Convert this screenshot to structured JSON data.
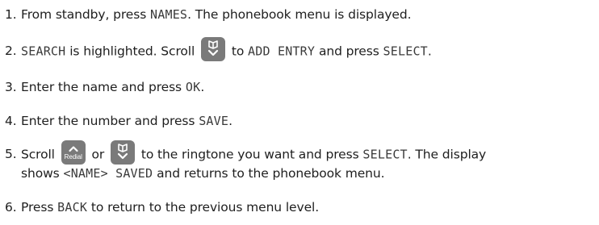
{
  "steps": [
    {
      "num": "1.",
      "parts": [
        "From standby, press ",
        "NAMES",
        ". The phonebook menu is displayed."
      ]
    },
    {
      "num": "2.",
      "parts": [
        "SEARCH",
        " is highlighted. Scroll ",
        " to ",
        "ADD ENTRY",
        " and press ",
        "SELECT",
        "."
      ]
    },
    {
      "num": "3.",
      "parts": [
        "Enter the name and press ",
        "OK",
        "."
      ]
    },
    {
      "num": "4.",
      "parts": [
        "Enter the number and press ",
        "SAVE",
        "."
      ]
    },
    {
      "num": "5.",
      "parts": [
        "Scroll ",
        " or ",
        " to the ringtone you want and press ",
        "SELECT",
        ". The display",
        "shows ",
        "<NAME> SAVED",
        " and returns to the phonebook menu."
      ]
    },
    {
      "num": "6.",
      "parts": [
        "Press ",
        "BACK",
        " to return to the previous menu level."
      ]
    }
  ],
  "icons": {
    "phonebook_down_key": "phonebook-down-icon",
    "redial_up_key": "redial-up-icon",
    "redial_label": "Redial",
    "key_color": "#7a7a7a"
  }
}
